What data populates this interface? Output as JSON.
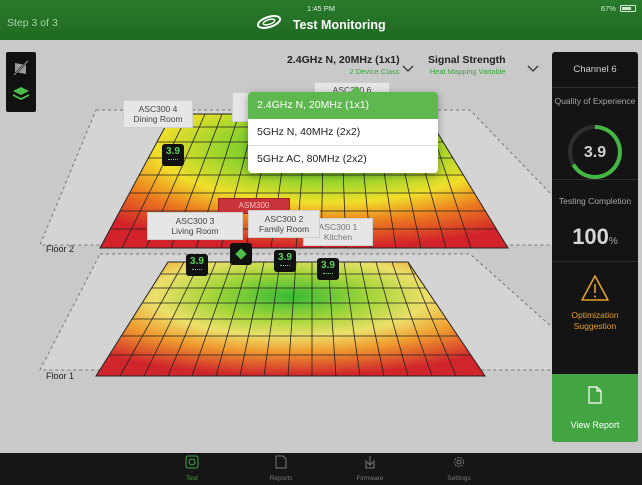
{
  "status_bar": {
    "time": "1:45 PM",
    "battery": "67%"
  },
  "header": {
    "step": "Step 3 of 3",
    "title": "Test Monitoring"
  },
  "band_selector": {
    "value": "2.4GHz N, 20MHz (1x1)",
    "sub": "2 Device Class",
    "options": [
      "2.4GHz N, 20MHz (1x1)",
      "5GHz N, 40MHz (2x2)",
      "5GHz AC, 80MHz (2x2)"
    ],
    "selected_index": 0
  },
  "metric_selector": {
    "value": "Signal Strength",
    "sub": "Heat Mapping Variable"
  },
  "right_panel": {
    "channel": "Channel 6",
    "qoe_label": "Quality of Experience",
    "qoe_value": "3.9",
    "testing_label": "Testing Completion",
    "testing_value": "100",
    "testing_unit": "%",
    "optimization_label": "Optimization Suggestion",
    "report_label": "View Report"
  },
  "floors": [
    {
      "name": "Floor 2",
      "aps": [
        {
          "name": "ASC300 4",
          "room": "Dining Room"
        },
        {
          "name": "ASC300 6",
          "room": ""
        },
        {
          "name": "ASM300",
          "room": ""
        }
      ],
      "node_values": [
        "3.9"
      ]
    },
    {
      "name": "Floor 1",
      "aps": [
        {
          "name": "ASC300 3",
          "room": "Living Room"
        },
        {
          "name": "ASC300 2",
          "room": "Family Room"
        },
        {
          "name": "ASC300 1",
          "room": "Kitchen"
        }
      ],
      "node_values": [
        "3.9",
        "3.9",
        "3.9"
      ]
    }
  ],
  "tabs": [
    {
      "label": "Test",
      "icon": "test-icon",
      "active": true
    },
    {
      "label": "Reports",
      "icon": "reports-icon",
      "active": false
    },
    {
      "label": "Firmware",
      "icon": "firmware-icon",
      "active": false
    },
    {
      "label": "Settings",
      "icon": "settings-icon",
      "active": false
    }
  ],
  "colors": {
    "accent": "#42a542",
    "warning": "#e59f2a",
    "header": "#24722a"
  }
}
